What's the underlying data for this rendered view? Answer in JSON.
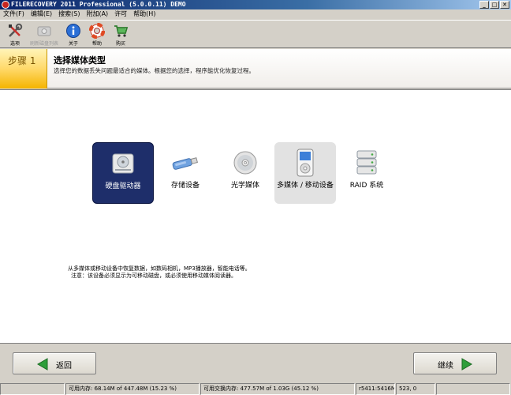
{
  "window": {
    "title": "FILERECOVERY 2011 Professional (5.0.0.11) DEMO",
    "buttons": [
      "_",
      "□",
      "✕"
    ]
  },
  "menu": [
    {
      "label": "文件(F)"
    },
    {
      "label": "编辑(E)"
    },
    {
      "label": "搜索(S)"
    },
    {
      "label": "附加(A)"
    },
    {
      "label": "许可"
    },
    {
      "label": "帮助(H)"
    }
  ],
  "toolbar": {
    "options_label": "选项",
    "refresh_label": "刷新磁盘列表",
    "about_label": "关于",
    "help_label": "帮助",
    "buy_label": "购买"
  },
  "step": {
    "badge": "步骤 1",
    "title": "选择媒体类型",
    "description": "选择您的数据丢失问题最适合的媒体。根据您的选择，程序能优化恢复过程。"
  },
  "media": [
    {
      "label": "硬盘驱动器",
      "icon": "hard-drive-icon",
      "state": "selected"
    },
    {
      "label": "存储设备",
      "icon": "usb-drive-icon",
      "state": "normal"
    },
    {
      "label": "光学媒体",
      "icon": "optical-disc-icon",
      "state": "normal"
    },
    {
      "label": "多媒体 / 移动设备",
      "icon": "media-player-icon",
      "state": "hover"
    },
    {
      "label": "RAID 系统",
      "icon": "raid-icon",
      "state": "normal"
    }
  ],
  "hint": {
    "line1": "从多媒体或移动设备中恢复数据，如数码相机，MP3播放器，智能电话等。",
    "line2": "注意：该设备必须显示为可移动磁盘，或必须使用移动媒体阅读器。"
  },
  "footer": {
    "back_label": "返回",
    "next_label": "继续"
  },
  "status": {
    "memory": "可用内存: 68.14M of 447.48M (15.23 %)",
    "swap": "可用交换内存: 477.57M of 1.03G (45.12 %)",
    "code": "r5411:5416M",
    "coords": "523, 0"
  },
  "colors": {
    "title_bar": "#0a246a",
    "selected_media": "#1e2e6a",
    "step_badge": "#ffd96a",
    "arrow_green": "#2e9e3a"
  }
}
